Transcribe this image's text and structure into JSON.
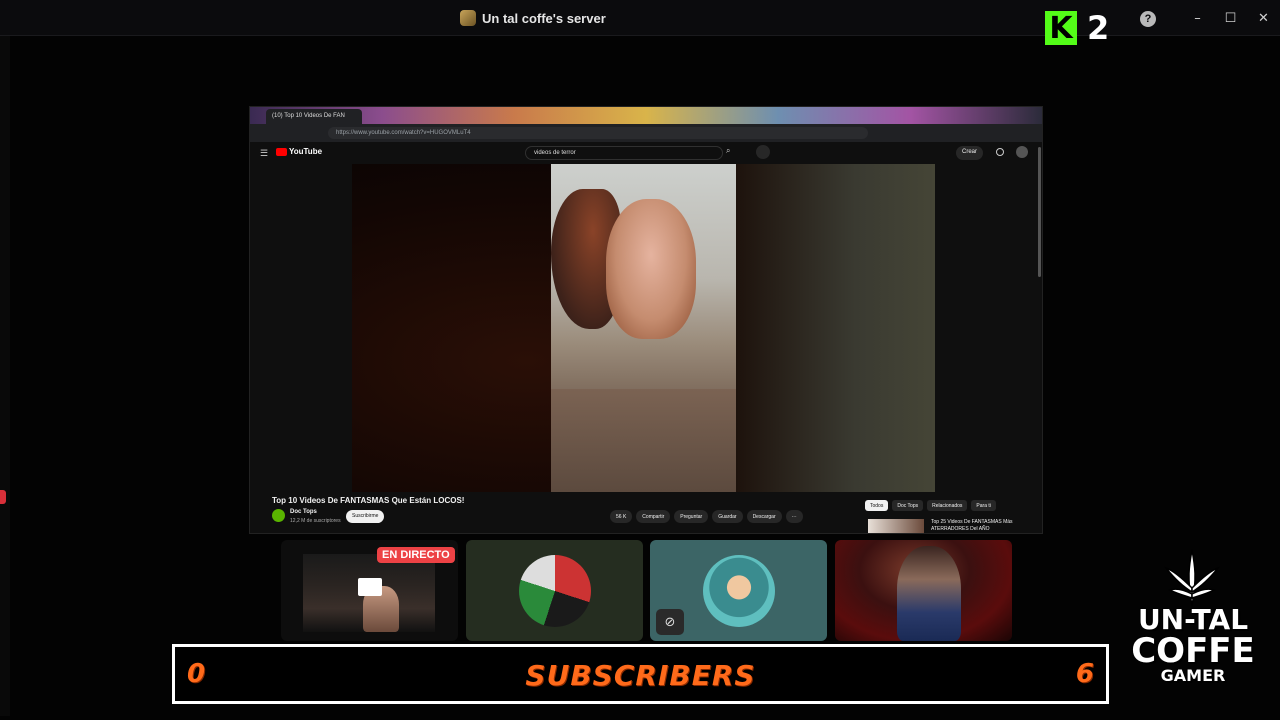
{
  "window": {
    "title": "Un tal coffe's server",
    "controls": {
      "minimize": "–",
      "maximize": "☐",
      "close": "✕"
    },
    "help_glyph": "?"
  },
  "kick": {
    "logo_letter": "K",
    "viewer_count": "2",
    "brand_color": "#53fc18"
  },
  "browser": {
    "tab_title": "(10) Top 10 Videos De FAN",
    "url": "https://www.youtube.com/watch?v=HUGOVMLuT4",
    "youtube": {
      "logo_text": "YouTube",
      "search_query": "videos de terror",
      "create_label": "Crear",
      "video_title": "Top 10 Videos De FANTASMAS Que Están LOCOS!",
      "channel_name": "Doc Tops",
      "channel_subs": "12,2 M de suscriptores",
      "subscribe_label": "Suscribirme",
      "actions": [
        "56 K",
        "Compartir",
        "Preguntar",
        "Guardar",
        "Descargar",
        "···"
      ],
      "chips": [
        "Todos",
        "Doc Tops",
        "Relacionados",
        "Para ti"
      ],
      "next_video_title": "Top 25 Videos De FANTASMAS Más ATERRADORES Del AÑO"
    }
  },
  "participants": [
    {
      "name": "stream-tile",
      "badge": "EN DIRECTO"
    },
    {
      "name": "avatar-tile-flag"
    },
    {
      "name": "avatar-tile-anime",
      "muted_icon": "mic-muted-icon"
    },
    {
      "name": "camera-tile"
    }
  ],
  "subscriber_bar": {
    "left_value": "0",
    "label": "SUBSCRIBERS",
    "right_value": "6",
    "accent_color": "#ff6a1a"
  },
  "logo": {
    "line1": "UN-TAL",
    "line2": "COFFE",
    "line3": "GAMER"
  }
}
